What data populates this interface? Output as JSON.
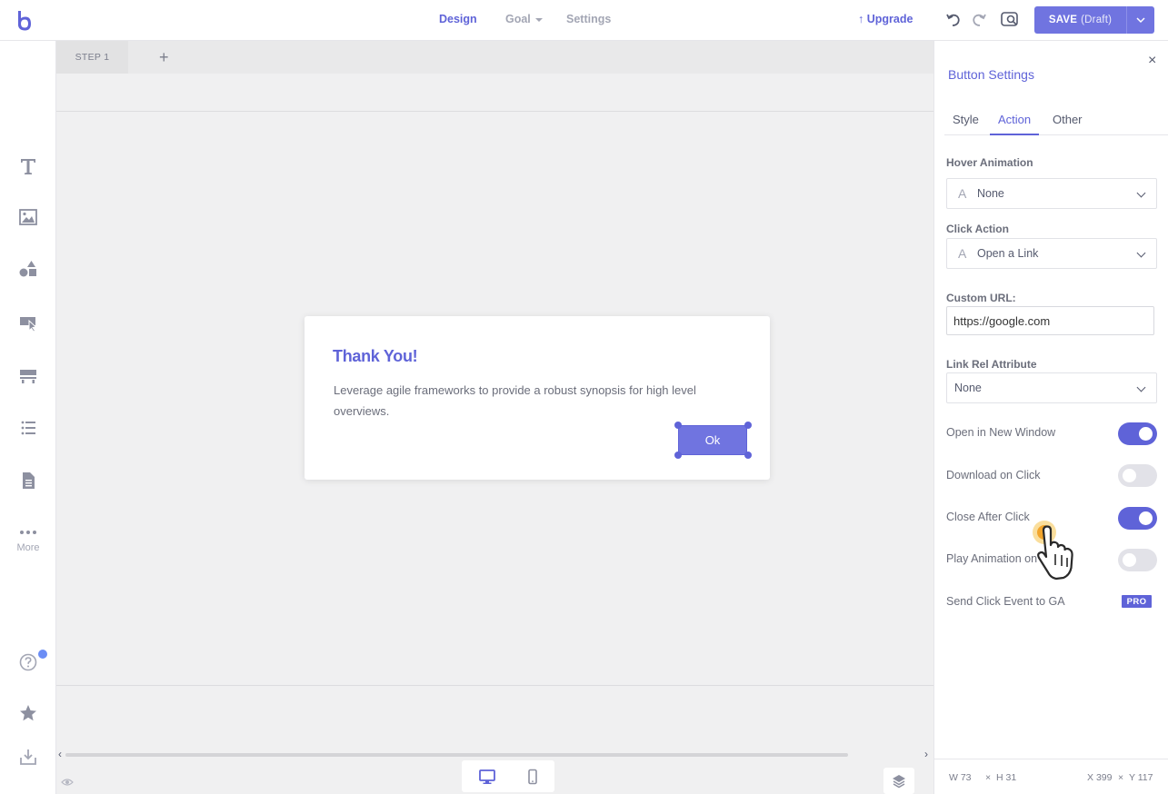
{
  "topbar": {
    "nav": [
      {
        "label": "Design",
        "active": true
      },
      {
        "label": "Goal",
        "active": false
      },
      {
        "label": "Settings",
        "active": false
      }
    ],
    "upgrade_label": "Upgrade",
    "save_label": "SAVE",
    "save_state": "(Draft)"
  },
  "leftrail": {
    "more_label": "More"
  },
  "steps": {
    "tabs": [
      "STEP 1"
    ],
    "add_label": "+"
  },
  "popup": {
    "title": "Thank You!",
    "body": "Leverage agile frameworks to provide a robust synopsis for high level overviews.",
    "button_label": "Ok"
  },
  "panel": {
    "title": "Button Settings",
    "close": "×",
    "tabs": [
      {
        "label": "Style",
        "active": false
      },
      {
        "label": "Action",
        "active": true
      },
      {
        "label": "Other",
        "active": false
      }
    ],
    "hover_animation": {
      "label": "Hover Animation",
      "value": "None"
    },
    "click_action": {
      "label": "Click Action",
      "value": "Open a Link"
    },
    "custom_url": {
      "label": "Custom URL:",
      "value": "https://google.com"
    },
    "link_rel": {
      "label": "Link Rel Attribute",
      "value": "None"
    },
    "toggles": [
      {
        "label": "Open in New Window",
        "on": true
      },
      {
        "label": "Download on Click",
        "on": false
      },
      {
        "label": "Close After Click",
        "on": true
      },
      {
        "label": "Play Animation on Click",
        "on": false
      }
    ],
    "ga": {
      "label": "Send Click Event to GA",
      "badge": "PRO"
    },
    "footer": {
      "w_label": "W",
      "w_value": "73",
      "h_label": "H",
      "h_value": "31",
      "x_label": "X",
      "x_value": "399",
      "y_label": "Y",
      "y_value": "117",
      "sep": "×"
    }
  },
  "colors": {
    "accent": "#5f63d8",
    "button": "#7074e0",
    "toggle_off": "#e2e2e8",
    "canvas": "#f0f0f1"
  }
}
